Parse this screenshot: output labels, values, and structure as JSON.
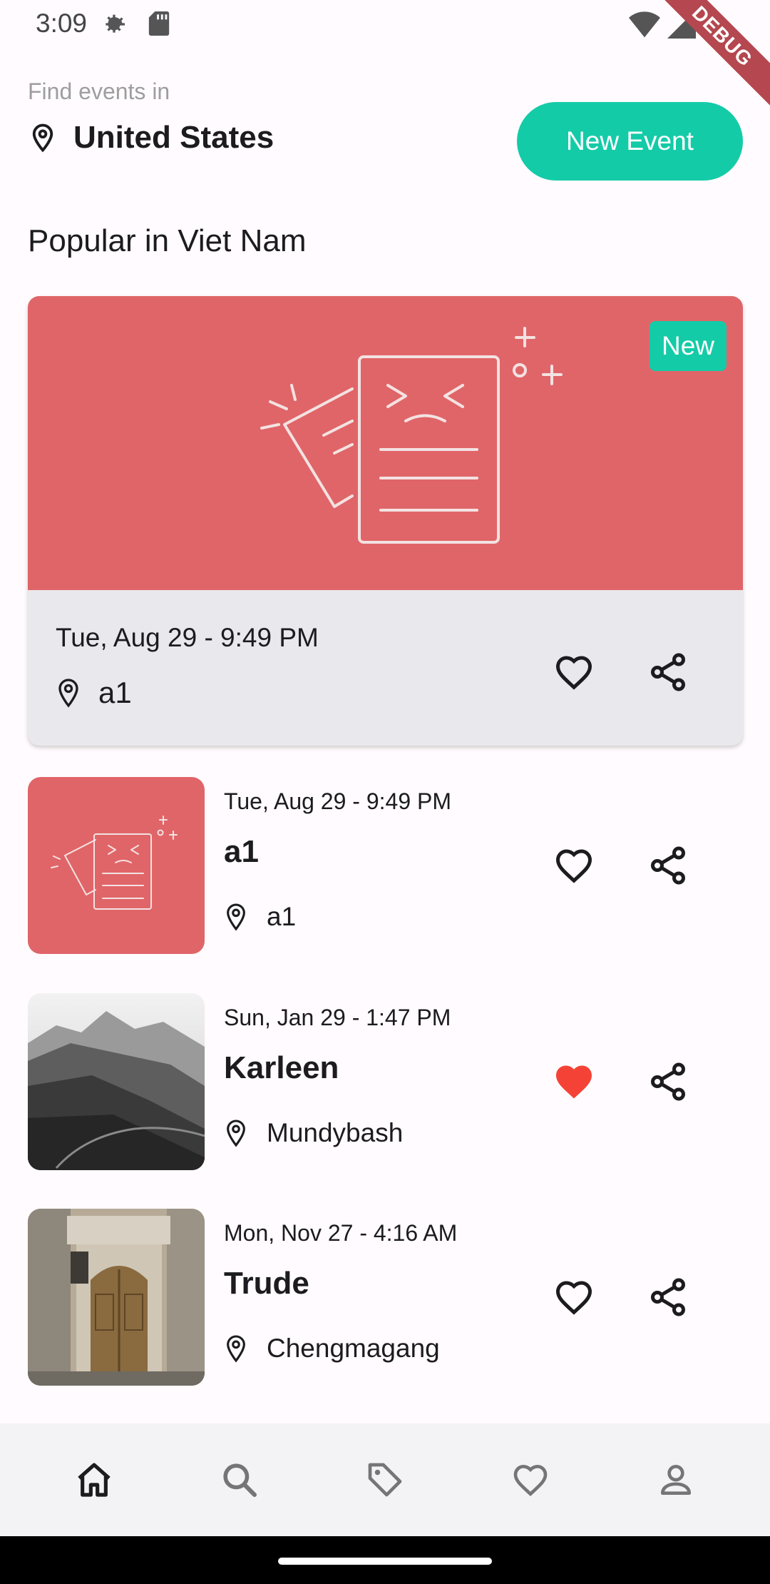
{
  "status_bar": {
    "time": "3:09",
    "debug_label": "DEBUG"
  },
  "header": {
    "find_label": "Find events in",
    "location": "United States",
    "new_event_label": "New Event"
  },
  "section_title": "Popular in Viet Nam",
  "featured": {
    "badge": "New",
    "date": "Tue, Aug 29 - 9:49 PM",
    "location": "a1",
    "favorited": false,
    "image_color": "#e06568"
  },
  "events": [
    {
      "date": "Tue, Aug 29 - 9:49 PM",
      "title": "a1",
      "location": "a1",
      "favorited": false,
      "thumbnail": "placeholder-illustration"
    },
    {
      "date": "Sun, Jan 29 - 1:47 PM",
      "title": "Karleen",
      "location": "Mundybash",
      "favorited": true,
      "thumbnail": "mountain-photo"
    },
    {
      "date": "Mon, Nov 27 - 4:16 AM",
      "title": "Trude",
      "location": "Chengmagang",
      "favorited": false,
      "thumbnail": "door-photo"
    }
  ],
  "bottom_nav": [
    "home-icon",
    "search-icon",
    "tag-icon",
    "heart-icon",
    "profile-icon"
  ],
  "colors": {
    "accent": "#14cba8",
    "favorite": "#f44336",
    "card_red": "#e06568"
  }
}
